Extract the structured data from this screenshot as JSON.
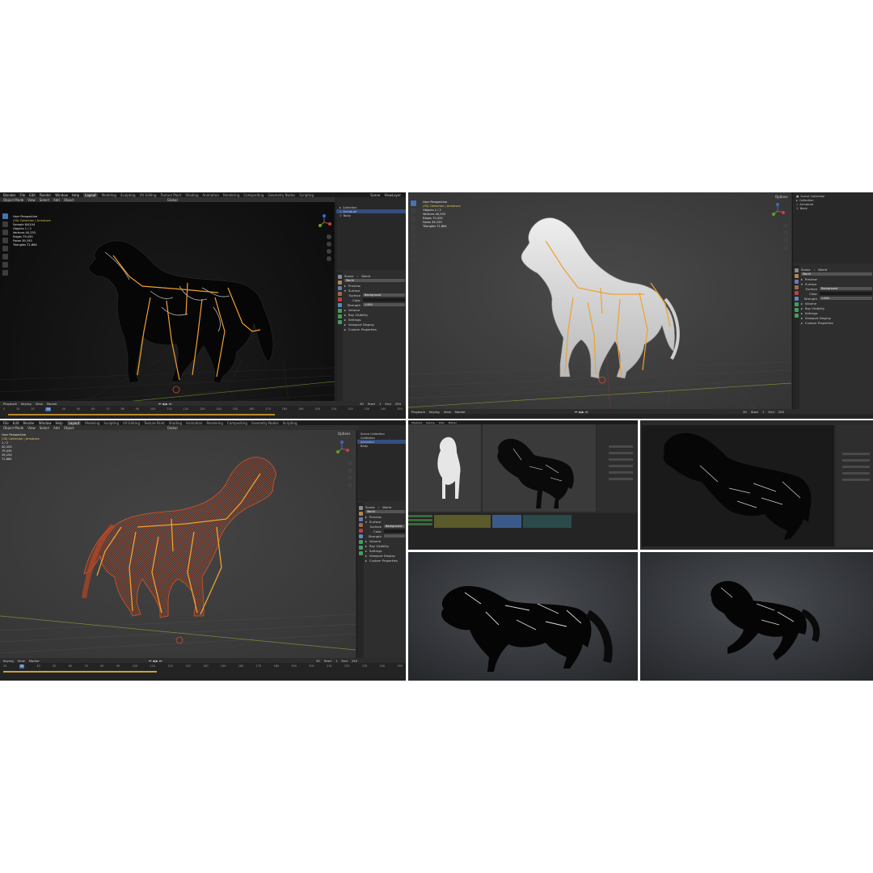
{
  "colors": {
    "bone": "#f0a030",
    "selected": "#4772b3",
    "axis_x": "#7a2a2a",
    "axis_y": "#5a7a2a",
    "wire": "#d0461f"
  },
  "icons": [
    "select-box-icon",
    "cursor-icon",
    "move-icon",
    "rotate-icon",
    "scale-icon",
    "transform-icon",
    "annotate-icon",
    "measure-icon",
    "play-icon",
    "camera-icon",
    "hand-icon",
    "zoom-icon",
    "eye-icon",
    "scene-icon",
    "world-icon"
  ],
  "panel1": {
    "app_title": "Blender",
    "menus": [
      "File",
      "Edit",
      "Render",
      "Window",
      "Help"
    ],
    "workspaces": [
      "Layout",
      "Modeling",
      "Sculpting",
      "UV Editing",
      "Texture Paint",
      "Shading",
      "Animation",
      "Rendering",
      "Compositing",
      "Geometry Nodes",
      "Scripting"
    ],
    "tool_header": [
      "Object Mode",
      "View",
      "Select",
      "Add",
      "Object"
    ],
    "global_label": "Global",
    "view_info": "User Perspective",
    "collection_info": "(30) Collection | Armature",
    "sample_info": "Sample 8/4104",
    "stats": [
      "Objects    1 / 2",
      "Vertices   40,253",
      "Edges      79,435",
      "Faces      39,193",
      "Triangles  71,864"
    ],
    "scene_label": "Scene",
    "view_layer_label": "ViewLayer",
    "outliner": [
      "Collection",
      "Armature",
      "Body"
    ],
    "props_crumb": [
      "Scene",
      "World"
    ],
    "world_name": "World",
    "sections": [
      "Preview",
      "Surface"
    ],
    "surface_label": "Surface",
    "surface_value": "Background",
    "color_label": "Color",
    "strength_label": "Strength",
    "strength_value": "1.000",
    "more_sections": [
      "Volume",
      "Ray Visibility",
      "Settings",
      "Viewport Display",
      "Custom Properties"
    ],
    "timeline_menus": [
      "Playback",
      "Keying",
      "View",
      "Marker"
    ],
    "frame_start_label": "Start",
    "frame_start": "1",
    "frame_end_label": "End",
    "frame_end": "250",
    "current_frame": "30",
    "ruler": [
      "0",
      "10",
      "20",
      "30",
      "40",
      "50",
      "60",
      "70",
      "80",
      "90",
      "100",
      "110",
      "120",
      "130",
      "140",
      "150",
      "160",
      "170",
      "180",
      "190",
      "200",
      "210",
      "220",
      "230",
      "240",
      "250"
    ]
  },
  "panel2": {
    "view_info": "User Perspective",
    "collection_info": "(30) Collection | Armature",
    "stats": [
      "Objects    1 / 2",
      "Vertices   40,253",
      "Edges      79,435",
      "Faces      39,193",
      "Triangles  71,864"
    ],
    "options_label": "Options",
    "outliner": [
      "Scene Collection",
      "Collection",
      "Armature",
      "Body"
    ],
    "props_crumb": [
      "Scene",
      "World"
    ],
    "world_name": "World",
    "sections": [
      "Preview",
      "Surface"
    ],
    "surface_label": "Surface",
    "surface_value": "Background",
    "color_label": "Color",
    "strength_label": "Strength",
    "strength_value": "1.000",
    "more_sections": [
      "Volume",
      "Ray Visibility",
      "Settings",
      "Viewport Display",
      "Custom Properties"
    ],
    "timeline_menus": [
      "Playback",
      "Keying",
      "View",
      "Marker"
    ],
    "frame_start_label": "Start",
    "frame_start": "1",
    "frame_end_label": "End",
    "frame_end": "250",
    "current_frame": "30"
  },
  "panel3": {
    "menus": [
      "File",
      "Edit",
      "Render",
      "Window",
      "Help"
    ],
    "workspaces": [
      "Layout",
      "Modeling",
      "Sculpting",
      "UV Editing",
      "Texture Paint",
      "Shading",
      "Animation",
      "Rendering",
      "Compositing",
      "Geometry Nodes",
      "Scripting"
    ],
    "tool_header": [
      "Object Mode",
      "View",
      "Select",
      "Add",
      "Object"
    ],
    "global_label": "Global",
    "view_info": "User Perspective",
    "collection_info": "(30) Collection | Armature",
    "stats": [
      "1 / 2",
      "40,253",
      "79,435",
      "39,193",
      "71,864"
    ],
    "options_label": "Options",
    "outliner": [
      "Scene Collection",
      "Collection",
      "Armature",
      "Body"
    ],
    "props_crumb": [
      "Scene",
      "World"
    ],
    "world_name": "World",
    "sections": [
      "Preview",
      "Surface"
    ],
    "surface_label": "Surface",
    "surface_value": "Background",
    "color_label": "Color",
    "strength_label": "Strength",
    "more_sections": [
      "Volume",
      "Ray Visibility",
      "Settings",
      "Viewport Display",
      "Custom Properties"
    ],
    "timeline_menus": [
      "Keying",
      "View",
      "Marker"
    ],
    "frame_start_label": "Start",
    "frame_start": "1",
    "frame_end_label": "End",
    "frame_end": "250",
    "current_frame": "30",
    "ruler": [
      "20",
      "30",
      "40",
      "50",
      "60",
      "70",
      "80",
      "90",
      "100",
      "110",
      "120",
      "130",
      "140",
      "150",
      "160",
      "170",
      "180",
      "190",
      "200",
      "210",
      "220",
      "230",
      "240",
      "250"
    ]
  },
  "panel4": {
    "timeline_menus": [
      "Playback",
      "Keying",
      "View",
      "Marker"
    ]
  }
}
